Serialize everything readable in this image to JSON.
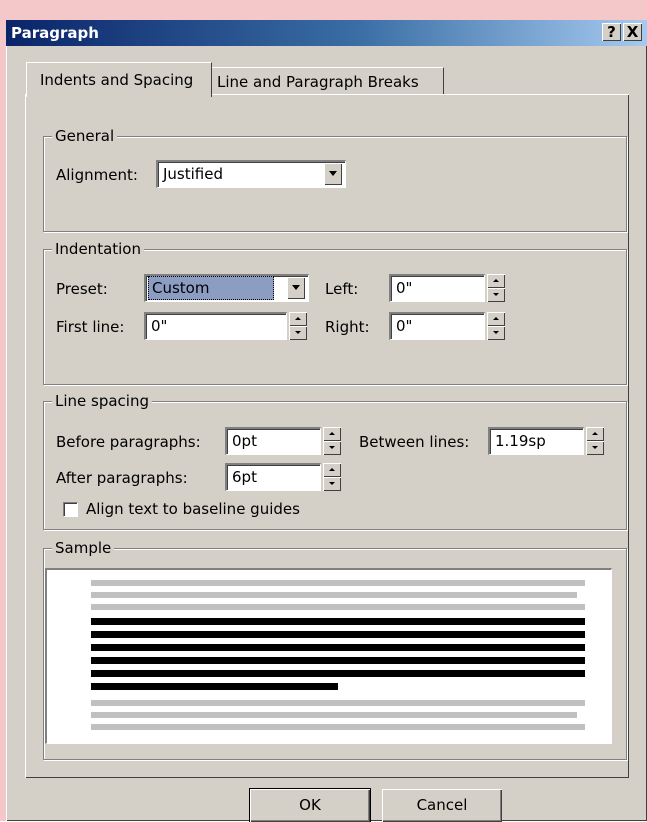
{
  "window": {
    "title": "Paragraph",
    "help_label": "?",
    "close_label": "X"
  },
  "tabs": [
    {
      "label": "Indents and Spacing",
      "active": true
    },
    {
      "label": "Line and Paragraph Breaks",
      "active": false
    }
  ],
  "general": {
    "legend": "General",
    "alignment_label": "Alignment:",
    "alignment_value": "Justified"
  },
  "indentation": {
    "legend": "Indentation",
    "preset_label": "Preset:",
    "preset_value": "Custom",
    "left_label": "Left:",
    "left_value": "0\"",
    "first_line_label": "First line:",
    "first_line_value": "0\"",
    "right_label": "Right:",
    "right_value": "0\""
  },
  "line_spacing": {
    "legend": "Line spacing",
    "before_label": "Before paragraphs:",
    "before_value": "0pt",
    "between_label": "Between lines:",
    "between_value": "1.19sp",
    "after_label": "After paragraphs:",
    "after_value": "6pt",
    "baseline_label": "Align text to baseline guides",
    "baseline_checked": false
  },
  "sample": {
    "legend": "Sample"
  },
  "buttons": {
    "ok": "OK",
    "cancel": "Cancel"
  },
  "colors": {
    "titlebar_start": "#0a246a",
    "titlebar_end": "#a6caf0",
    "face": "#d4d0c8",
    "selection": "#8b9dc3"
  }
}
